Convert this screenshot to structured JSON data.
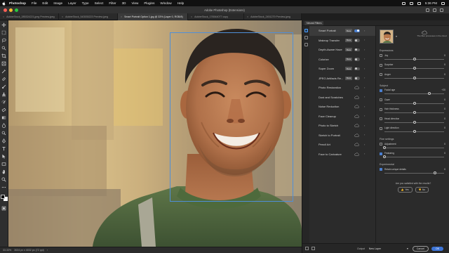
{
  "menubar": {
    "app": "Photoshop",
    "items": [
      "File",
      "Edit",
      "Image",
      "Layer",
      "Type",
      "Select",
      "Filter",
      "3D",
      "View",
      "Plugins",
      "Window",
      "Help"
    ],
    "time": "5:36 PM"
  },
  "window": {
    "title": "Adobe Photoshop (Extensions)"
  },
  "doc_tabs": [
    {
      "label": "AdobeStock_285324221.jpeg Preview.jpeg",
      "active": false
    },
    {
      "label": "AdobeStock_543535223 Preview.jpeg",
      "active": false
    },
    {
      "label": "Smart Portrait Option 1.jpg @ 33% (Layer 0, RGB/8)",
      "active": true
    },
    {
      "label": "AdobeStock_176544077 copy",
      "active": false
    },
    {
      "label": "AdobeStock_2451279 Preview.jpeg",
      "active": false
    }
  ],
  "statusbar": {
    "zoom": "33.33%",
    "info": "3024 px x 4032 px (72 ppi)"
  },
  "panel": {
    "tab": "Neural Filters",
    "filters": [
      {
        "name": "Smart Portrait",
        "badge": "Beta",
        "state": "on",
        "active": true
      },
      {
        "name": "Makeup Transfer",
        "badge": "Beta",
        "state": "off",
        "active": false
      },
      {
        "name": "Depth-Aware Haze",
        "badge": "Beta",
        "state": "off",
        "active": false
      },
      {
        "name": "Colorize",
        "badge": "Beta",
        "state": "off",
        "active": false
      },
      {
        "name": "Super Zoom",
        "badge": "Beta",
        "state": "off",
        "active": false
      },
      {
        "name": "JPEG Artifacts Re...",
        "badge": "Beta",
        "state": "off",
        "active": false
      },
      {
        "name": "Photo Restoration",
        "badge": "",
        "state": "cloud",
        "active": false
      },
      {
        "name": "Dust and Scratches",
        "badge": "",
        "state": "cloud",
        "active": false
      },
      {
        "name": "Noise Reduction",
        "badge": "",
        "state": "cloud",
        "active": false
      },
      {
        "name": "Face Cleanup",
        "badge": "",
        "state": "cloud",
        "active": false
      },
      {
        "name": "Photo to Sketch",
        "badge": "",
        "state": "cloud",
        "active": false
      },
      {
        "name": "Sketch to Portrait",
        "badge": "",
        "state": "cloud",
        "active": false
      },
      {
        "name": "Pencil Art",
        "badge": "",
        "state": "cloud",
        "active": false
      },
      {
        "name": "Face to Caricature",
        "badge": "",
        "state": "cloud",
        "active": false
      }
    ],
    "thumb_note": "The filter processes in the cloud",
    "sections": [
      {
        "title": "Expressions",
        "rows": [
          {
            "label": "Joy",
            "value": "0",
            "checked": false,
            "level": 0.5
          },
          {
            "label": "Surprise",
            "value": "0",
            "checked": false,
            "level": 0.5
          },
          {
            "label": "Anger",
            "value": "0",
            "checked": false,
            "level": 0.5
          }
        ]
      },
      {
        "title": "Subject",
        "rows": [
          {
            "label": "Facial age",
            "value": "+20",
            "checked": true,
            "level": 0.75
          },
          {
            "label": "Gaze",
            "value": "0",
            "checked": false,
            "level": 0.5
          },
          {
            "label": "Hair thickness",
            "value": "0",
            "checked": false,
            "level": 0.5
          },
          {
            "label": "Head direction",
            "value": "0",
            "checked": false,
            "level": 0.5
          },
          {
            "label": "Light direction",
            "value": "0",
            "checked": false,
            "level": 0.5
          }
        ]
      },
      {
        "title": "Fine settings",
        "rows": [
          {
            "label": "Adjustment",
            "value": "0",
            "checked": false,
            "level": 0.0
          },
          {
            "label": "Featuring",
            "value": "0",
            "checked": true,
            "level": 0.0
          }
        ]
      },
      {
        "title": "Experimental",
        "rows": [
          {
            "label": "Retain unique details",
            "value": "0",
            "checked": true,
            "level": 0.85
          }
        ]
      }
    ],
    "satisfied": "Are you satisfied with the results?",
    "yes": "Yes",
    "no": "No",
    "footer": {
      "output_label": "Output",
      "output_value": "New Layer",
      "cancel": "Cancel",
      "ok": "OK"
    }
  },
  "colors": {
    "accent": "#4a7fd0",
    "selection": "#4f8fd8",
    "ok": "#3d74d6"
  }
}
